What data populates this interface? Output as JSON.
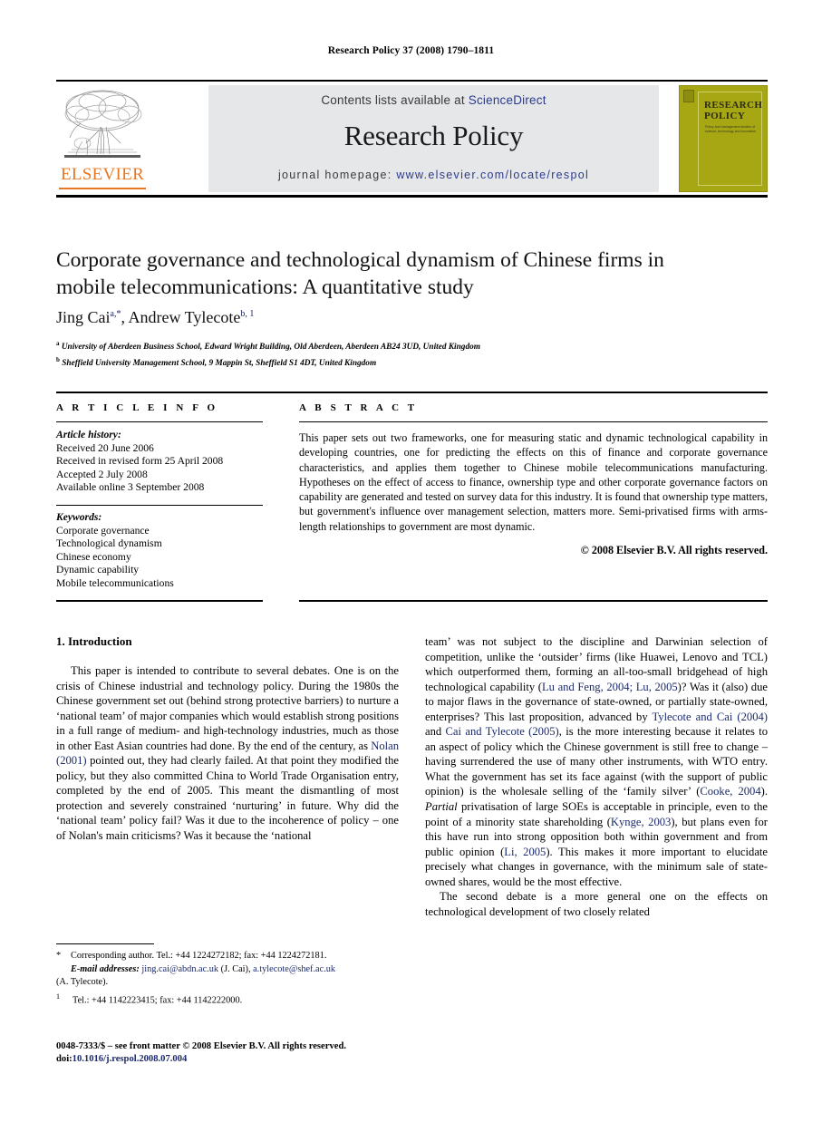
{
  "running_head": "Research Policy 37 (2008) 1790–1811",
  "masthead": {
    "contents_prefix": "Contents lists available at ",
    "contents_link": "ScienceDirect",
    "journal_title": "Research Policy",
    "homepage_prefix": "journal homepage: ",
    "homepage_url": "www.elsevier.com/locate/respol",
    "publisher_wordmark": "ELSEVIER",
    "cover": {
      "title_line1": "RESEARCH",
      "title_line2": "POLICY",
      "subtitle": "Policy and management studies of science, technology and innovation"
    },
    "link_color": "#2b3a8f",
    "band_color": "#e6e7e9",
    "cover_color": "#a6a712",
    "elsevier_orange": "#e87722"
  },
  "article": {
    "title": "Corporate governance and technological dynamism of Chinese firms in mobile telecommunications: A quantitative study",
    "authors_html": "Jing Cai<sup>a,*</sup>, Andrew Tylecote<sup>b, 1</sup>",
    "affiliation_a": "University of Aberdeen Business School, Edward Wright Building, Old Aberdeen, Aberdeen AB24 3UD, United Kingdom",
    "affiliation_b": "Sheffield University Management School, 9 Mappin St, Sheffield S1 4DT, United Kingdom"
  },
  "article_info": {
    "heading": "A R T I C L E    I N F O",
    "history_label": "Article history:",
    "history": [
      "Received 20 June 2006",
      "Received in revised form 25 April 2008",
      "Accepted 2 July 2008",
      "Available online 3 September 2008"
    ],
    "keywords_label": "Keywords:",
    "keywords": [
      "Corporate governance",
      "Technological dynamism",
      "Chinese economy",
      "Dynamic capability",
      "Mobile telecommunications"
    ]
  },
  "abstract": {
    "heading": "A B S T R A C T",
    "text": "This paper sets out two frameworks, one for measuring static and dynamic technological capability in developing countries, one for predicting the effects on this of finance and corporate governance characteristics, and applies them together to Chinese mobile telecommunications manufacturing. Hypotheses on the effect of access to finance, ownership type and other corporate governance factors on capability are generated and tested on survey data for this industry. It is found that ownership type matters, but government's influence over management selection, matters more. Semi-privatised firms with arms-length relationships to government are most dynamic.",
    "copyright": "© 2008 Elsevier B.V. All rights reserved."
  },
  "body": {
    "section_heading": "1.  Introduction",
    "left_paragraph_1": "This paper is intended to contribute to several debates. One is on the crisis of Chinese industrial and technology policy. During the 1980s the Chinese government set out (behind strong protective barriers) to nurture a ‘national team’ of major companies which would establish strong positions in a full range of medium- and high-technology industries, much as those in other East Asian countries had done. By the end of the century, as ",
    "left_cite_1": "Nolan (2001)",
    "left_paragraph_1b": " pointed out, they had clearly failed. At that point they modified the policy, but they also committed China to World Trade Organisation entry, completed by the end of 2005. This meant the dismantling of most protection and severely constrained ‘nurturing’ in future. Why did the ‘national team’ policy fail? Was it due to the incoherence of policy – one of Nolan's main criticisms? Was it because the ‘national",
    "right_paragraph_1": "team’ was not subject to the discipline and Darwinian selection of competition, unlike the ‘outsider’ firms (like Huawei, Lenovo and TCL) which outperformed them, forming an all-too-small bridgehead of high technological capability (",
    "right_cite_1": "Lu and Feng, 2004; Lu, 2005",
    "right_paragraph_1b": ")? Was it (also) due to major flaws in the governance of state-owned, or partially state-owned, enterprises? This last proposition, advanced by ",
    "right_cite_2": "Tylecote and Cai (2004)",
    "right_paragraph_1c": " and ",
    "right_cite_3": "Cai and Tylecote (2005)",
    "right_paragraph_1d": ", is the more interesting because it relates to an aspect of policy which the Chinese government is still free to change – having surrendered the use of many other instruments, with WTO entry. What the government has set its face against (with the support of public opinion) is the wholesale selling of the ‘family silver’ (",
    "right_cite_4": "Cooke, 2004",
    "right_paragraph_1e": "). ",
    "right_italic_1": "Partial",
    "right_paragraph_1f": " privatisation of large SOEs is acceptable in principle, even to the point of a minority state shareholding (",
    "right_cite_5": "Kynge, 2003",
    "right_paragraph_1g": "), but plans even for this have run into strong opposition both within government and from public opinion (",
    "right_cite_6": "Li, 2005",
    "right_paragraph_1h": "). This makes it more important to elucidate precisely what changes in governance, with the minimum sale of state-owned shares, would be the most effective.",
    "right_paragraph_2": "The second debate is a more general one on the effects on technological development of two closely related"
  },
  "footnotes": {
    "corresponding_mark": "*",
    "corresponding_text": "Corresponding author. Tel.: +44 1224272182; fax: +44 1224272181.",
    "email_label": "E-mail addresses:",
    "email_1": "jing.cai@abdn.ac.uk",
    "email_1_owner": " (J. Cai), ",
    "email_2": "a.tylecote@shef.ac.uk",
    "email_2_owner": "(A. Tylecote).",
    "fn1_mark": "1",
    "fn1_text": "Tel.: +44 1142223415; fax: +44 1142222000.",
    "frontmatter": "0048-7333/$ – see front matter © 2008 Elsevier B.V. All rights reserved.",
    "doi_label": "doi:",
    "doi_value": "10.1016/j.respol.2008.07.004"
  }
}
